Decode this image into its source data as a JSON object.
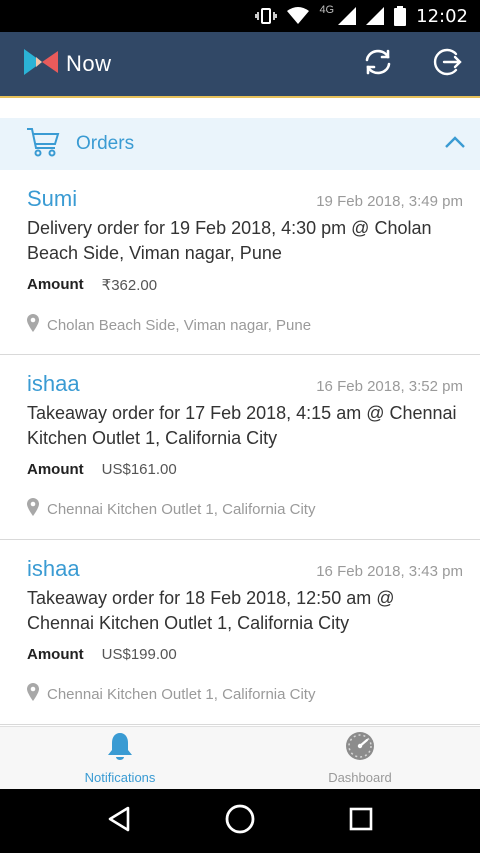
{
  "status_bar": {
    "time": "12:02",
    "network": "4G"
  },
  "app_bar": {
    "app_name": "Now"
  },
  "section": {
    "title": "Orders"
  },
  "orders": [
    {
      "customer": "Sumi",
      "timestamp": "19 Feb 2018, 3:49 pm",
      "description": "Delivery order for 19 Feb 2018, 4:30 pm @ Cholan Beach Side, Viman nagar, Pune",
      "amount_label": "Amount",
      "amount": "₹362.00",
      "location": "Cholan Beach Side, Viman nagar, Pune"
    },
    {
      "customer": "ishaa",
      "timestamp": "16 Feb 2018, 3:52 pm",
      "description": "Takeaway order for 17 Feb 2018, 4:15 am @ Chennai Kitchen Outlet 1, California City",
      "amount_label": "Amount",
      "amount": "US$161.00",
      "location": "Chennai Kitchen Outlet 1, California City"
    },
    {
      "customer": "ishaa",
      "timestamp": "16 Feb 2018, 3:43 pm",
      "description": "Takeaway order for 18 Feb 2018, 12:50 am @ Chennai Kitchen Outlet 1, California City",
      "amount_label": "Amount",
      "amount": "US$199.00",
      "location": "Chennai Kitchen Outlet 1, California City"
    }
  ],
  "bottom_nav": {
    "notifications": "Notifications",
    "dashboard": "Dashboard"
  },
  "colors": {
    "app_bar": "#314866",
    "accent": "#3a9bd3",
    "section_bg": "#eaf4fb"
  }
}
